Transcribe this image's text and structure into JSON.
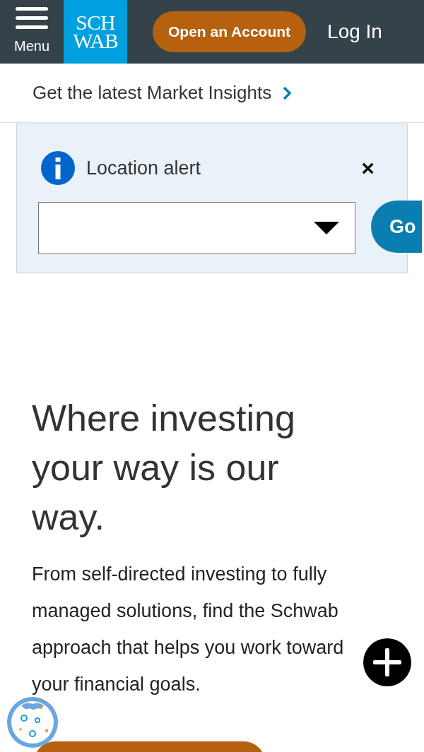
{
  "header": {
    "menu_label": "Menu",
    "logo_lines": [
      "SCH",
      "WAB"
    ],
    "open_account": "Open an Account",
    "login": "Log In"
  },
  "insights_link": {
    "label": "Get the latest Market Insights"
  },
  "location_alert": {
    "title": "Location alert",
    "close": "×",
    "go_button": "Go"
  },
  "hero": {
    "heading": "Where investing your way is our way.",
    "body": "From self-directed investing to fully managed solutions, find the Schwab approach that helps you work toward your financial goals."
  }
}
